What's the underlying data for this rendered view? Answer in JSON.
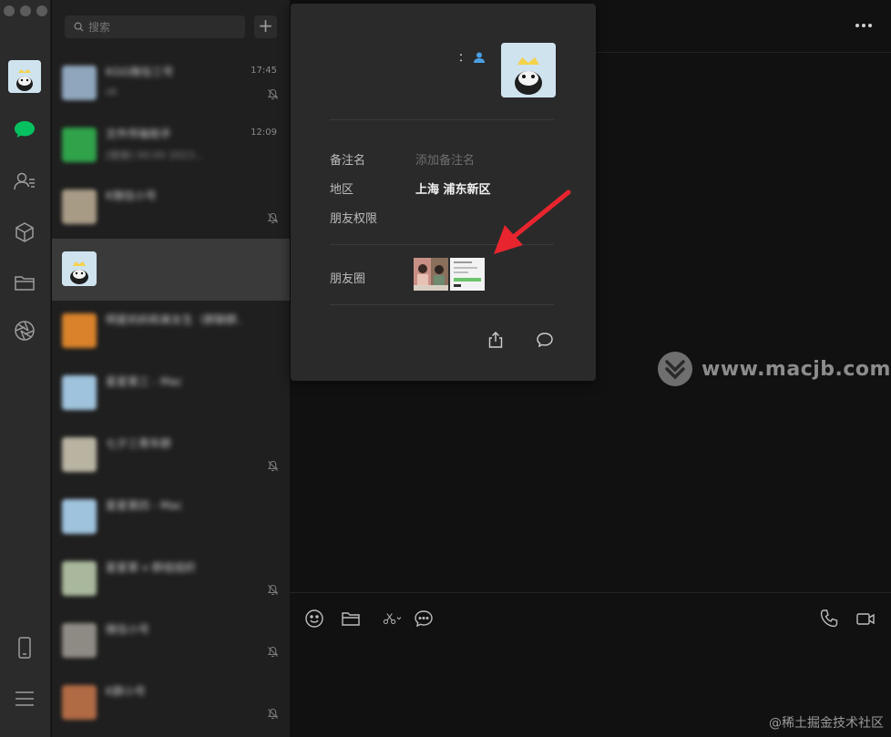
{
  "search": {
    "placeholder": "搜索"
  },
  "add_button": {
    "label": "+"
  },
  "conversations": [
    {
      "name": "KGG微信三号",
      "message": "ok",
      "time": "17:45",
      "muted": true,
      "avatar_color": "#8fa6bd"
    },
    {
      "name": "文件传输助手",
      "message": "[链接] 00:00 2023...",
      "time": "12:09",
      "muted": false,
      "avatar_color": "#2fa24a"
    },
    {
      "name": "K微信小号",
      "message": "",
      "time": "",
      "muted": true,
      "avatar_color": "#a89b86"
    },
    {
      "name": "",
      "message": "",
      "time": "",
      "muted": false,
      "avatar_color": "#cfe3ef",
      "active": true
    },
    {
      "name": "明星妈妈和美女生（群聊群…",
      "message": "",
      "time": "",
      "muted": false,
      "avatar_color": "#d9822b"
    },
    {
      "name": "星星第三 - Mac",
      "message": "",
      "time": "",
      "muted": false,
      "avatar_color": "#9fc3dd"
    },
    {
      "name": "七夕三青年群",
      "message": "",
      "time": "",
      "muted": true,
      "avatar_color": "#b9b3a2"
    },
    {
      "name": "星星第四 - Mac",
      "message": "",
      "time": "",
      "muted": false,
      "avatar_color": "#9fc3dd"
    },
    {
      "name": "星星第 v 群组组织",
      "message": "",
      "time": "",
      "muted": true,
      "avatar_color": "#a9b89c"
    },
    {
      "name": "微信小号",
      "message": "",
      "time": "",
      "muted": true,
      "avatar_color": "#8e8a84"
    },
    {
      "name": "K群小号",
      "message": "",
      "time": "",
      "muted": true,
      "avatar_color": "#b06a44"
    }
  ],
  "profile": {
    "nickname_suffix": "：",
    "rows": {
      "remark": {
        "label": "备注名",
        "value": "添加备注名"
      },
      "region": {
        "label": "地区",
        "value": "上海  浦东新区"
      },
      "permission": {
        "label": "朋友权限",
        "value": ""
      },
      "moments": {
        "label": "朋友圈"
      }
    }
  },
  "watermark": {
    "text": "www.macjb.com"
  },
  "credit": {
    "text": "@稀土掘金技术社区"
  },
  "colors": {
    "accent_green": "#07c160",
    "arrow_red": "#e8252f",
    "contact_blue": "#4a9fe3"
  },
  "icons": {
    "rail": [
      "chat-icon",
      "contacts-icon",
      "mini-programs-icon",
      "folder-icon",
      "moments-shutter-icon",
      "phone-device-icon",
      "menu-icon"
    ],
    "popover_actions": [
      "share-icon",
      "message-icon"
    ],
    "chat_tools": [
      "emoji-icon",
      "file-icon",
      "scissors-icon",
      "chat-history-icon",
      "voice-call-icon",
      "video-call-icon"
    ]
  }
}
